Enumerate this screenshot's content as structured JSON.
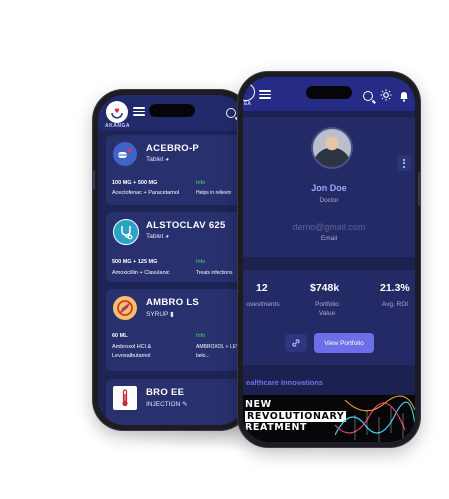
{
  "brand": {
    "name": "AKANGA"
  },
  "back_phone": {
    "cards": [
      {
        "title": "ACEBRO-P",
        "form": "Tablet",
        "strength": "100 MG + 500 MG",
        "composition": "Aceclofenac + Paracetamol",
        "info_label": "Info",
        "info_text": "Helps in relievin"
      },
      {
        "title": "ALSTOCLAV 625",
        "form": "Tablet",
        "strength": "500 MG + 125 MG",
        "composition": "Amoxicillin + Clavulanic",
        "info_label": "Info",
        "info_text": "Treats infections"
      },
      {
        "title": "AMBRO LS",
        "form": "SYRUP",
        "strength": "60 ML",
        "composition_line1": "Ambroxol HCl &",
        "composition_line2": "Levosalbutamol",
        "info_label": "Info",
        "info_line1": "AMBROXOL + LEVO",
        "info_line2": "belo..."
      },
      {
        "title": "BRO EE",
        "form": "INJECTION"
      }
    ]
  },
  "front_phone": {
    "brand_short": "EA",
    "profile": {
      "name": "Jon Doe",
      "role": "Doctor",
      "email": "demo@gmail.com",
      "email_label": "Email"
    },
    "stats": [
      {
        "value": "12",
        "label": "ovestments"
      },
      {
        "value": "$748k",
        "label_line1": "Portfolio",
        "label_line2": "Value"
      },
      {
        "value": "21.3%",
        "label": "Avg. ROI"
      }
    ],
    "view_portfolio_label": "View Portfolio",
    "section_title": "ealthcare Innovations",
    "banner": {
      "line1": "NEW",
      "line2": "REVOLUTIONARY",
      "line3": "REATMENT"
    }
  },
  "colors": {
    "screen_bg": "#1e2454",
    "card_bg": "#28306e",
    "accent": "#6c6fe9",
    "info_green": "#53d86a"
  }
}
